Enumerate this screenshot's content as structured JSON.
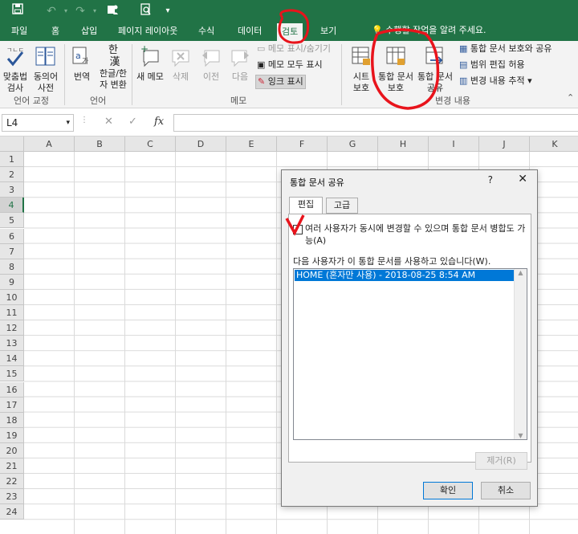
{
  "qat": {
    "save_icon": "save-icon",
    "undo_icon": "undo-icon",
    "redo_icon": "redo-icon"
  },
  "tabs": [
    "파일",
    "홈",
    "삽입",
    "페이지 레이아웃",
    "수식",
    "데이터",
    "검토",
    "보기"
  ],
  "active_tab": "검토",
  "tell_me": "수행할 작업을 알려 주세요.",
  "ribbon": {
    "groups": {
      "proofing": "언어 교정",
      "language": "언어",
      "comments": "메모",
      "changes": "변경 내용"
    },
    "spell_check": [
      "맞춤법",
      "검사"
    ],
    "thesaurus": [
      "동의어",
      "사전"
    ],
    "translate": "번역",
    "hangul_hanja": [
      "한글/한",
      "자 변환"
    ],
    "new_comment": "새 메모",
    "delete": "삭제",
    "previous": "이전",
    "next": "다음",
    "show_hide_comment": "메모 표시/숨기기",
    "show_all_comments": "메모 모두 표시",
    "show_ink": "잉크 표시",
    "protect_sheet": [
      "시트",
      "보호"
    ],
    "protect_workbook": [
      "통합 문서",
      "보호"
    ],
    "share_workbook": [
      "통합 문서",
      "공유"
    ],
    "protect_share_workbook": "통합 문서 보호와 공유",
    "allow_edit_ranges": "범위 편집 허용",
    "track_changes": "변경 내용 추적"
  },
  "formula_bar": {
    "name_box": "L4",
    "cancel": "✕",
    "enter": "✓",
    "fx": "fx",
    "value": ""
  },
  "columns": [
    "A",
    "B",
    "C",
    "D",
    "E",
    "F",
    "G",
    "H",
    "I",
    "J",
    "K"
  ],
  "rows": [
    "1",
    "2",
    "3",
    "4",
    "5",
    "6",
    "7",
    "8",
    "9",
    "10",
    "11",
    "12",
    "13",
    "14",
    "15",
    "16",
    "17",
    "18",
    "19",
    "20",
    "21",
    "22",
    "23",
    "24"
  ],
  "selected_row": "4",
  "dialog": {
    "title": "통합 문서 공유",
    "help": "?",
    "close": "✕",
    "tabs": [
      "편집",
      "고급"
    ],
    "checkbox_label": "여러 사용자가 동시에 변경할 수 있으며 통합 문서 병합도 가능(A)",
    "checkbox_checked": false,
    "list_label": "다음 사용자가 이 통합 문서를 사용하고 있습니다(W).",
    "users": [
      "HOME (혼자만 사용) - 2018-08-25 8:54 AM"
    ],
    "remove_button": "제거(R)",
    "ok_button": "확인",
    "cancel_button": "취소"
  },
  "colors": {
    "brand": "#217346",
    "annotation": "#e8141c",
    "selection": "#0078d7"
  }
}
